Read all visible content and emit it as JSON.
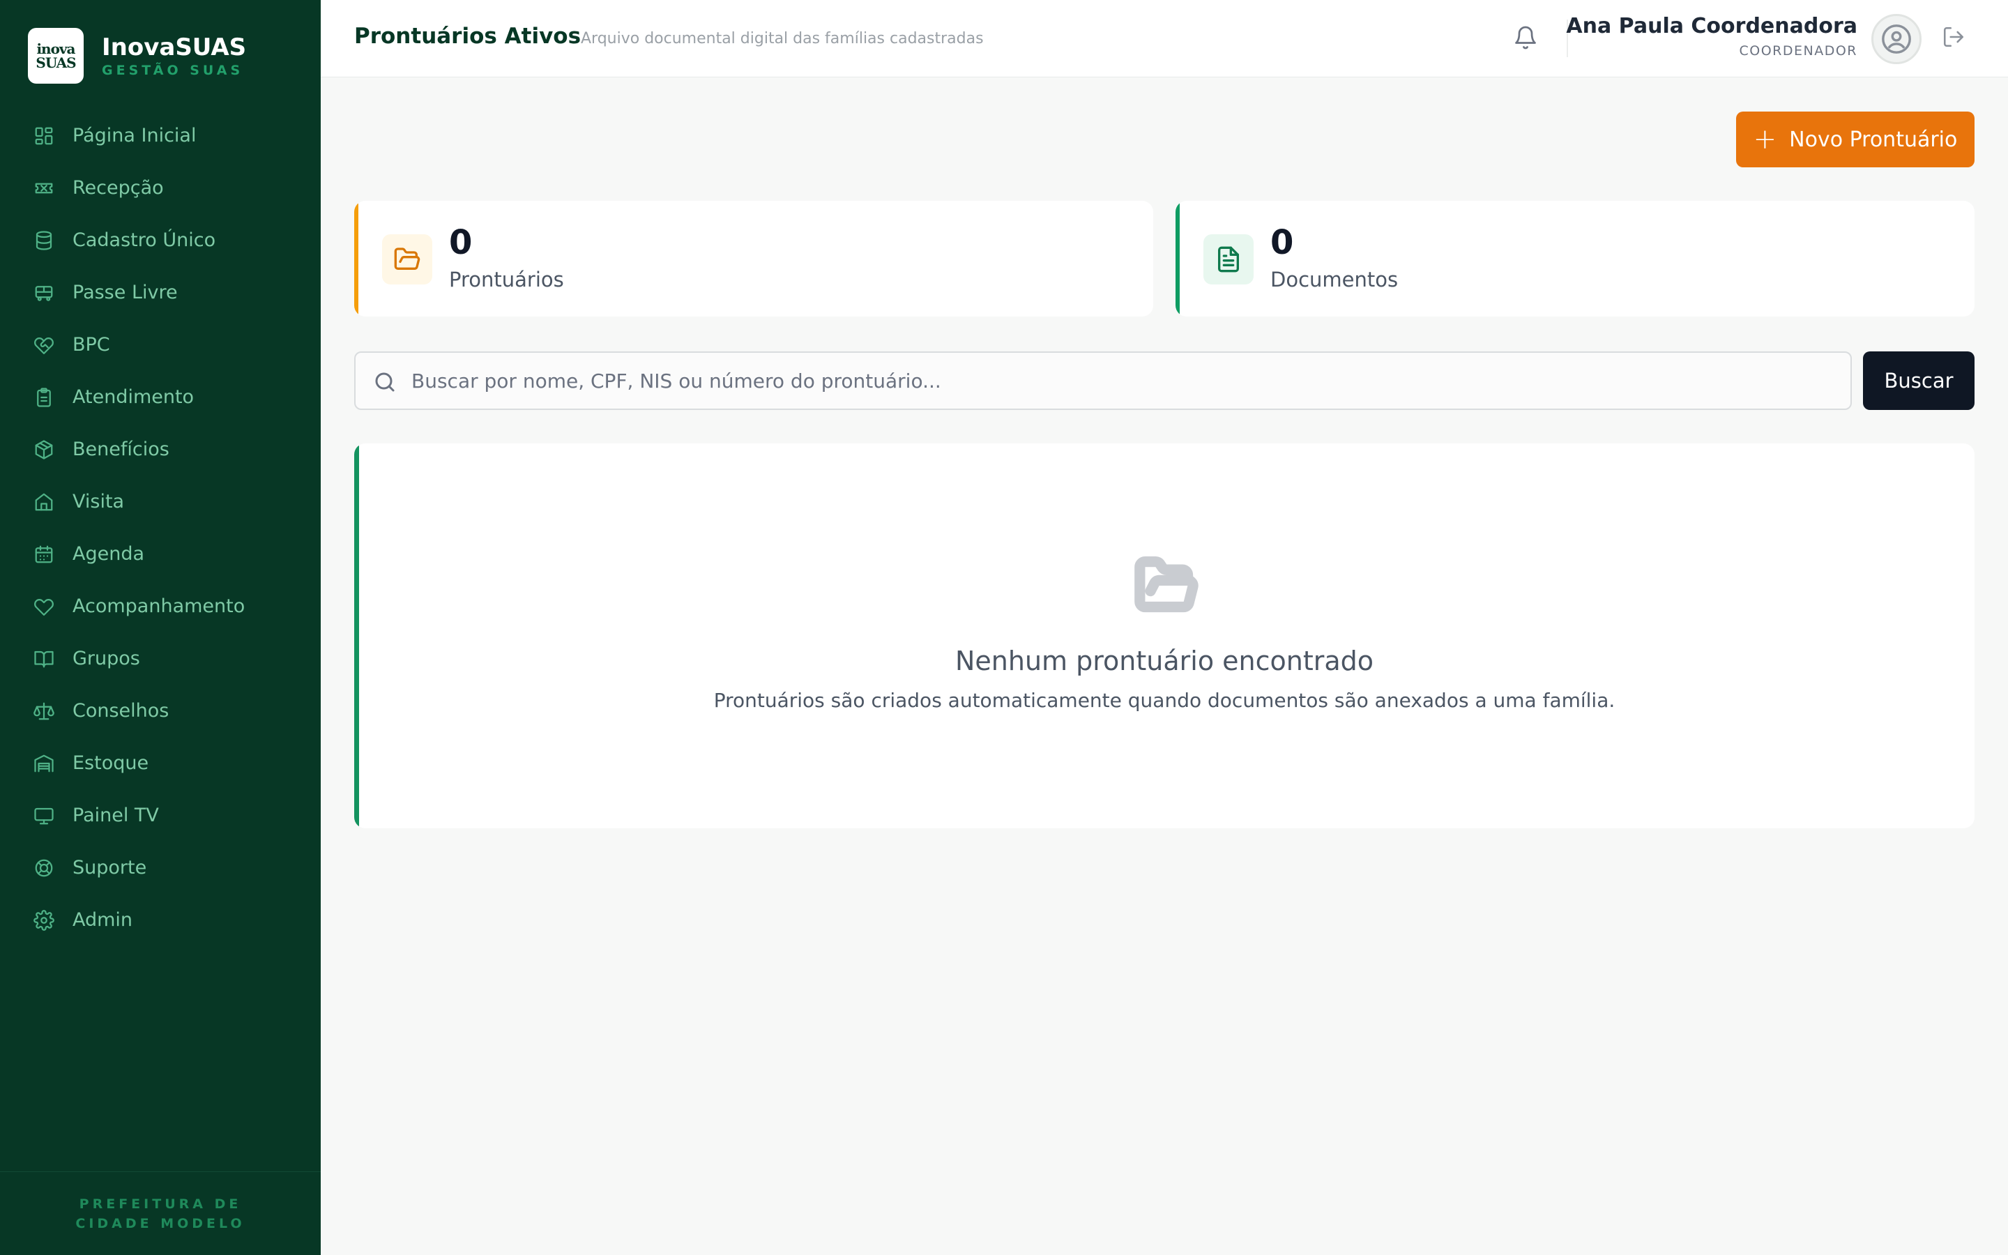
{
  "brand": {
    "logo_text_top": "inova",
    "logo_text_bottom": "SUAS",
    "name": "InovaSUAS",
    "subtitle": "GESTÃO SUAS"
  },
  "sidebar": {
    "items": [
      {
        "label": "Página Inicial",
        "icon": "grid-icon"
      },
      {
        "label": "Recepção",
        "icon": "ticket-icon"
      },
      {
        "label": "Cadastro Único",
        "icon": "database-icon"
      },
      {
        "label": "Passe Livre",
        "icon": "bus-icon"
      },
      {
        "label": "BPC",
        "icon": "heart-handshake-icon"
      },
      {
        "label": "Atendimento",
        "icon": "clipboard-icon"
      },
      {
        "label": "Benefícios",
        "icon": "package-icon"
      },
      {
        "label": "Visita",
        "icon": "home-icon"
      },
      {
        "label": "Agenda",
        "icon": "calendar-icon"
      },
      {
        "label": "Acompanhamento",
        "icon": "heart-icon"
      },
      {
        "label": "Grupos",
        "icon": "book-open-icon"
      },
      {
        "label": "Conselhos",
        "icon": "scale-icon"
      },
      {
        "label": "Estoque",
        "icon": "warehouse-icon"
      },
      {
        "label": "Painel TV",
        "icon": "monitor-icon"
      },
      {
        "label": "Suporte",
        "icon": "life-buoy-icon"
      },
      {
        "label": "Admin",
        "icon": "gear-icon"
      }
    ],
    "footer": "PREFEITURA DE CIDADE MODELO"
  },
  "header": {
    "title": "Prontuários Ativos",
    "subtitle": "Arquivo documental digital das famílias cadastradas",
    "user_name": "Ana Paula Coordenadora",
    "user_role": "COORDENADOR"
  },
  "actions": {
    "new_record": "Novo Prontuário",
    "search_button": "Buscar"
  },
  "stats": [
    {
      "value": "0",
      "label": "Prontuários",
      "accent": "#f59e0b",
      "icon_bg": "#fff7e6",
      "icon_color": "#d97706"
    },
    {
      "value": "0",
      "label": "Documentos",
      "accent": "#0f9d63",
      "icon_bg": "#e8f7ef",
      "icon_color": "#0f7a4d"
    }
  ],
  "search": {
    "placeholder": "Buscar por nome, CPF, NIS ou número do prontuário...",
    "value": ""
  },
  "empty_state": {
    "title": "Nenhum prontuário encontrado",
    "description": "Prontuários são criados automaticamente quando documentos são anexados a uma família."
  },
  "colors": {
    "sidebar_bg": "#073725",
    "primary_orange": "#e8740c",
    "dark_button": "#0f1724"
  }
}
